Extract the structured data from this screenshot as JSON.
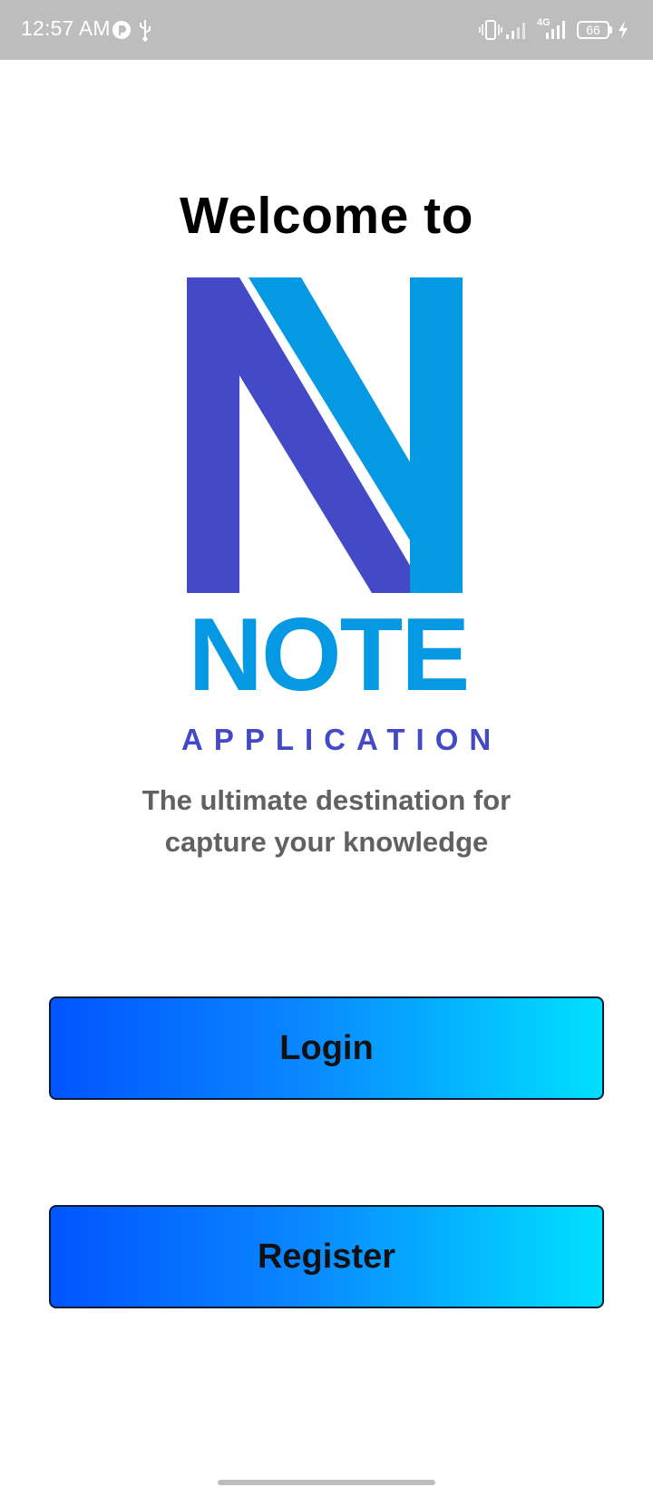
{
  "status_bar": {
    "time": "12:57 AM",
    "network": "4G",
    "battery": "66",
    "icons": [
      "app-notification-icon",
      "usb-icon",
      "vibrate-icon",
      "signal-icon",
      "network-signal-icon",
      "charging-icon"
    ]
  },
  "welcome": {
    "title": "Welcome to"
  },
  "logo": {
    "word": "NOTE",
    "subtitle": "APPLICATION",
    "colors": {
      "purple": "#4449c7",
      "blue": "#0499e2"
    }
  },
  "tagline": {
    "line1": "The ultimate destination for",
    "line2": "capture your knowledge"
  },
  "actions": {
    "login_label": "Login",
    "register_label": "Register",
    "gradient_start": "#0055ff",
    "gradient_end": "#00e0ff"
  }
}
